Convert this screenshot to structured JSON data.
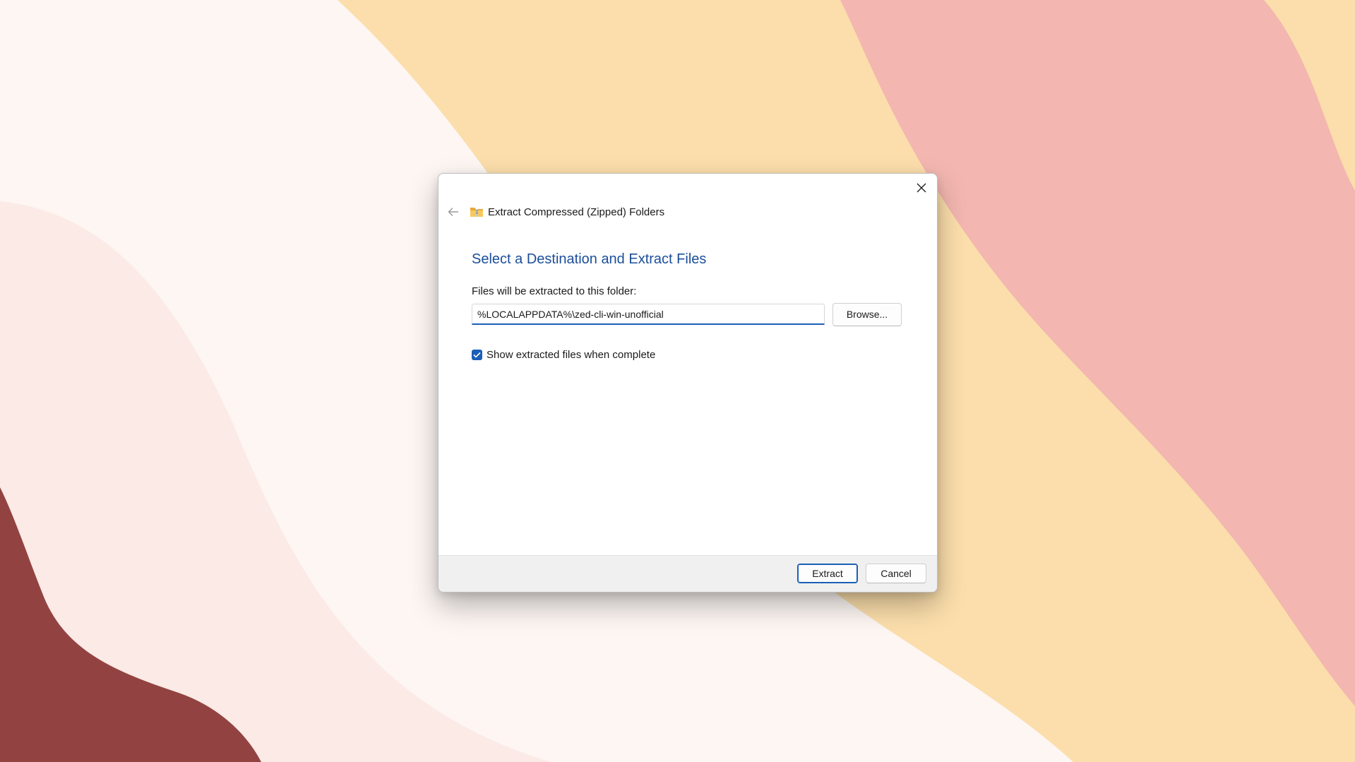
{
  "wallpaper": {
    "colors": {
      "base": "#fdf6f3",
      "blush": "#fbeae6",
      "peach": "#fbdeab",
      "pink": "#f3b6b0",
      "maroon": "#924341"
    }
  },
  "dialog": {
    "close_icon": "close-icon",
    "back_icon": "arrow-left-icon",
    "wizard_icon": "zipped-folder-icon",
    "wizard_title": "Extract Compressed (Zipped) Folders",
    "heading": "Select a Destination and Extract Files",
    "destination": {
      "label": "Files will be extracted to this folder:",
      "value": "%LOCALAPPDATA%\\zed-cli-win-unofficial",
      "browse_label": "Browse..."
    },
    "show_files": {
      "label": "Show extracted files when complete",
      "checked": true
    },
    "footer": {
      "extract_label": "Extract",
      "cancel_label": "Cancel"
    },
    "accent_color": "#1b5fb8",
    "heading_color": "#1b4e9b"
  }
}
